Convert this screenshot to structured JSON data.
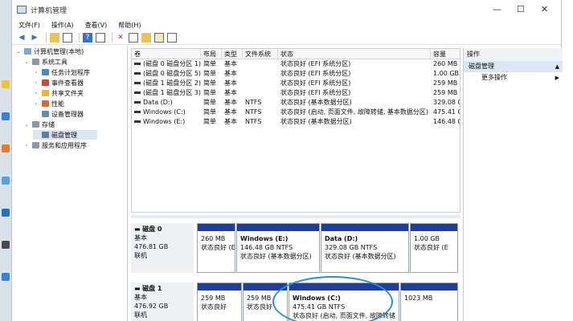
{
  "window": {
    "title": "计算机管理",
    "minimize": "—",
    "maximize": "☐",
    "close": "✕"
  },
  "menu": [
    "文件(F)",
    "操作(A)",
    "查看(V)",
    "帮助(H)"
  ],
  "tree": [
    {
      "label": "计算机管理(本地)",
      "level": 0,
      "twisty": "⌄"
    },
    {
      "label": "系统工具",
      "level": 1,
      "twisty": "⌄"
    },
    {
      "label": "任务计划程序",
      "level": 2,
      "twisty": "›"
    },
    {
      "label": "事件查看器",
      "level": 2,
      "twisty": "›"
    },
    {
      "label": "共享文件夹",
      "level": 2,
      "twisty": "›"
    },
    {
      "label": "性能",
      "level": 2,
      "twisty": "›"
    },
    {
      "label": "设备管理器",
      "level": 2,
      "twisty": ""
    },
    {
      "label": "存储",
      "level": 1,
      "twisty": "⌄"
    },
    {
      "label": "磁盘管理",
      "level": 2,
      "twisty": "",
      "selected": true
    },
    {
      "label": "服务和应用程序",
      "level": 1,
      "twisty": "›"
    }
  ],
  "list": {
    "headers": [
      "卷",
      "布局",
      "类型",
      "文件系统",
      "状态",
      "容量"
    ],
    "rows": [
      [
        "(磁盘 0 磁盘分区 1)",
        "简单",
        "基本",
        "",
        "状态良好 (EFI 系统分区)",
        "260 MB"
      ],
      [
        "(磁盘 0 磁盘分区 5)",
        "简单",
        "基本",
        "",
        "状态良好 (EFI 系统分区)",
        "1.00 GB"
      ],
      [
        "(磁盘 1 磁盘分区 2)",
        "简单",
        "基本",
        "",
        "状态良好 (EFI 系统分区)",
        "259 MB"
      ],
      [
        "(磁盘 1 磁盘分区 3)",
        "简单",
        "基本",
        "",
        "状态良好 (EFI 系统分区)",
        "259 MB"
      ],
      [
        "Data (D:)",
        "简单",
        "基本",
        "NTFS",
        "状态良好 (基本数据分区)",
        "329.08 GB"
      ],
      [
        "Windows (C:)",
        "简单",
        "基本",
        "NTFS",
        "状态良好 (启动, 页面文件, 故障转储, 基本数据分区)",
        "475.41 GB"
      ],
      [
        "Windows (E:)",
        "简单",
        "基本",
        "NTFS",
        "状态良好 (基本数据分区)",
        "146.48 GB"
      ]
    ]
  },
  "actions": {
    "header": "操作",
    "section": "磁盘管理",
    "more": "更多操作",
    "arrow": "▲",
    "more_arrow": "▶"
  },
  "disks": [
    {
      "name": "磁盘 0",
      "type": "基本",
      "size": "476.81 GB",
      "status": "联机",
      "parts": [
        {
          "title": "",
          "size": "260 MB",
          "status": "状态良好 (EFI"
        },
        {
          "title": "Windows (E:)",
          "size": "146.48 GB NTFS",
          "status": "状态良好 (基本数据分区)"
        },
        {
          "title": "Data (D:)",
          "size": "329.08 GB NTFS",
          "status": "状态良好 (基本数据分区)"
        },
        {
          "title": "",
          "size": "1.00 GB",
          "status": "状态良好 (E"
        }
      ]
    },
    {
      "name": "磁盘 1",
      "type": "基本",
      "size": "476.92 GB",
      "status": "联机",
      "parts": [
        {
          "title": "",
          "size": "259 MB",
          "status": "状态良好"
        },
        {
          "title": "",
          "size": "259 MB",
          "status": "状态良好"
        },
        {
          "title": "Windows (C:)",
          "size": "475.41 GB NTFS",
          "status": "状态良好 (启动, 页面文件, 故障转储"
        },
        {
          "title": "",
          "size": "1023 MB",
          "status": ""
        }
      ]
    }
  ]
}
